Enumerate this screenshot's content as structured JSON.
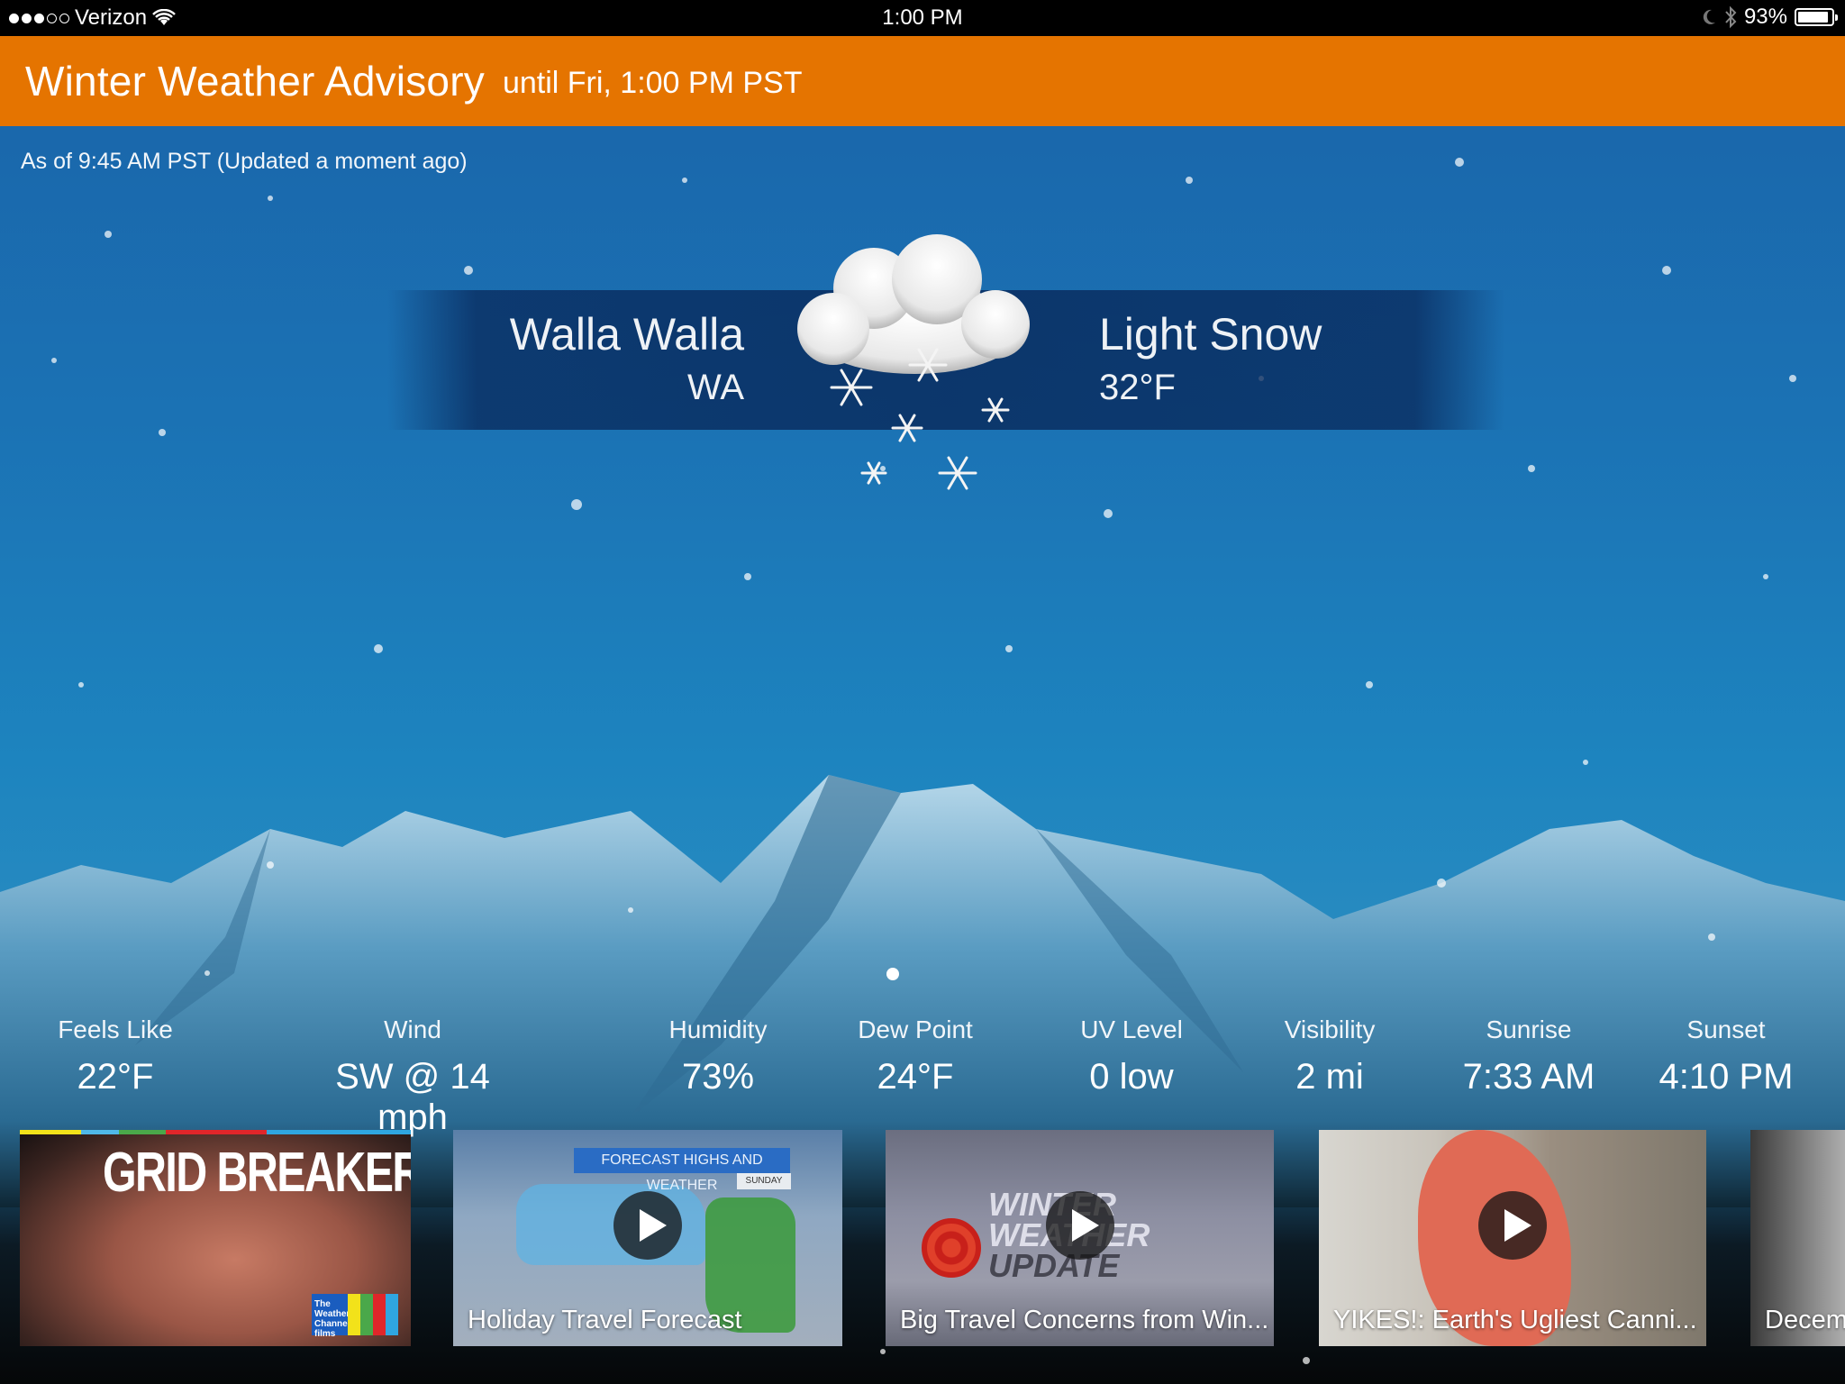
{
  "status_bar": {
    "signal_bars_filled": 3,
    "signal_bars_total": 5,
    "carrier": "Verizon",
    "wifi_icon": "wifi-icon",
    "time": "1:00 PM",
    "moon_icon": "do-not-disturb-icon",
    "bluetooth_icon": "bluetooth-icon",
    "battery_percent": "93%",
    "battery_level": 0.93
  },
  "advisory": {
    "title": "Winter Weather Advisory",
    "subtitle": "until Fri, 1:00 PM PST",
    "color": "#e57400"
  },
  "updated": "As of 9:45 AM PST (Updated a moment ago)",
  "location": {
    "city": "Walla Walla",
    "state": "WA"
  },
  "current": {
    "condition": "Light Snow",
    "temperature": "32°F",
    "icon": "snow-cloud-icon"
  },
  "pager": {
    "current_page": 1,
    "total_pages": 1
  },
  "stats": [
    {
      "label": "Feels Like",
      "value": "22°F"
    },
    {
      "label": "Wind",
      "value": "SW @ 14 mph"
    },
    {
      "label": "Humidity",
      "value": "73%"
    },
    {
      "label": "Dew Point",
      "value": "24°F"
    },
    {
      "label": "UV Level",
      "value": "0 low"
    },
    {
      "label": "Visibility",
      "value": "2 mi"
    },
    {
      "label": "Sunrise",
      "value": "7:33 AM"
    },
    {
      "label": "Sunset",
      "value": "4:10 PM"
    }
  ],
  "videos": [
    {
      "title": "",
      "brand": "GRID BREAKERS",
      "logo": "The Weather Channel films",
      "has_play": false
    },
    {
      "title": "Holiday Travel Forecast",
      "overlay": "FORECAST HIGHS AND WEATHER",
      "overlay_day": "SUNDAY",
      "has_play": true
    },
    {
      "title": "Big Travel Concerns from Win...",
      "overlay": [
        "WINTER",
        "WEATHER",
        "UPDATE"
      ],
      "has_play": true
    },
    {
      "title": "YIKES!: Earth's Ugliest Canni...",
      "has_play": true
    },
    {
      "title": "Decem",
      "has_play": false
    }
  ]
}
